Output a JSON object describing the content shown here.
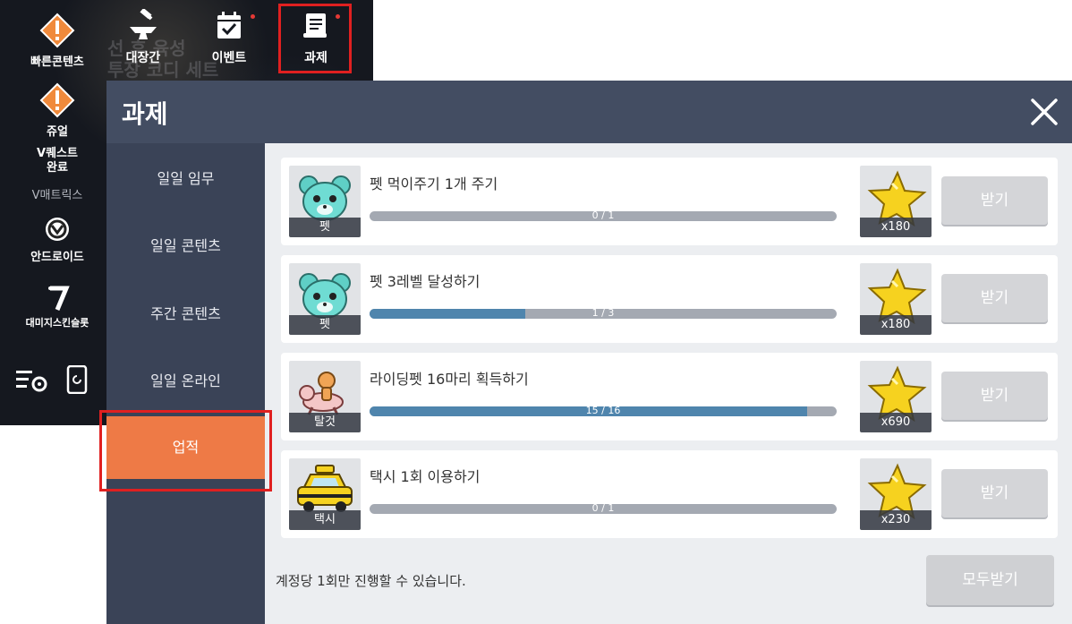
{
  "side_menu": {
    "items": [
      {
        "label": "빠른콘텐츠",
        "icon": "warning-icon"
      },
      {
        "label": "쥬얼",
        "icon": "warning-icon"
      },
      {
        "label": "V퀘스트 완료",
        "icon": ""
      },
      {
        "label": "V매트릭스",
        "icon": ""
      },
      {
        "label": "안드로이드",
        "icon": "android-icon"
      },
      {
        "label": "대미지스킨슬롯",
        "icon": "seven-icon"
      }
    ],
    "bottom_icons": [
      "settings-menu-icon",
      "phone-refresh-icon"
    ]
  },
  "top_menu": {
    "items": [
      {
        "label": "대장간",
        "icon": "anvil-icon",
        "badge": false
      },
      {
        "label": "이벤트",
        "icon": "calendar-check-icon",
        "badge": true
      },
      {
        "label": "과제",
        "icon": "scroll-icon",
        "badge": true
      }
    ]
  },
  "background_text": {
    "line1": "선",
    "line2": "후 육성",
    "line3": "투장 코디 세트"
  },
  "dialog": {
    "title": "과제",
    "close_icon": "close-icon",
    "nav": [
      {
        "label": "일일 임무",
        "active": false
      },
      {
        "label": "일일 콘텐츠",
        "active": false
      },
      {
        "label": "주간 콘텐츠",
        "active": false
      },
      {
        "label": "일일 온라인",
        "active": false
      },
      {
        "label": "업적",
        "active": true
      }
    ],
    "quests": [
      {
        "icon": "pet-bear-icon",
        "tag": "펫",
        "title": "펫 먹이주기 1개 주기",
        "progress_text": "0 / 1",
        "progress": 0.0,
        "reward_icon": "star-icon",
        "reward_qty": "x180",
        "button": "받기"
      },
      {
        "icon": "pet-bear-icon",
        "tag": "펫",
        "title": "펫 3레벨 달성하기",
        "progress_text": "1 / 3",
        "progress": 0.3333,
        "reward_icon": "star-icon",
        "reward_qty": "x180",
        "button": "받기"
      },
      {
        "icon": "mount-icon",
        "tag": "탈것",
        "title": "라이딩펫 16마리 획득하기",
        "progress_text": "15 / 16",
        "progress": 0.9375,
        "reward_icon": "star-icon",
        "reward_qty": "x690",
        "button": "받기"
      },
      {
        "icon": "taxi-icon",
        "tag": "택시",
        "title": "택시 1회 이용하기",
        "progress_text": "0 / 1",
        "progress": 0.0,
        "reward_icon": "star-icon",
        "reward_qty": "x230",
        "button": "받기"
      }
    ],
    "footer_note": "계정당 1회만 진행할 수 있습니다.",
    "claim_all": "모두받기"
  },
  "colors": {
    "accent": "#ee7a46",
    "progress_fill": "#4f85ad",
    "highlight": "#e02020"
  }
}
